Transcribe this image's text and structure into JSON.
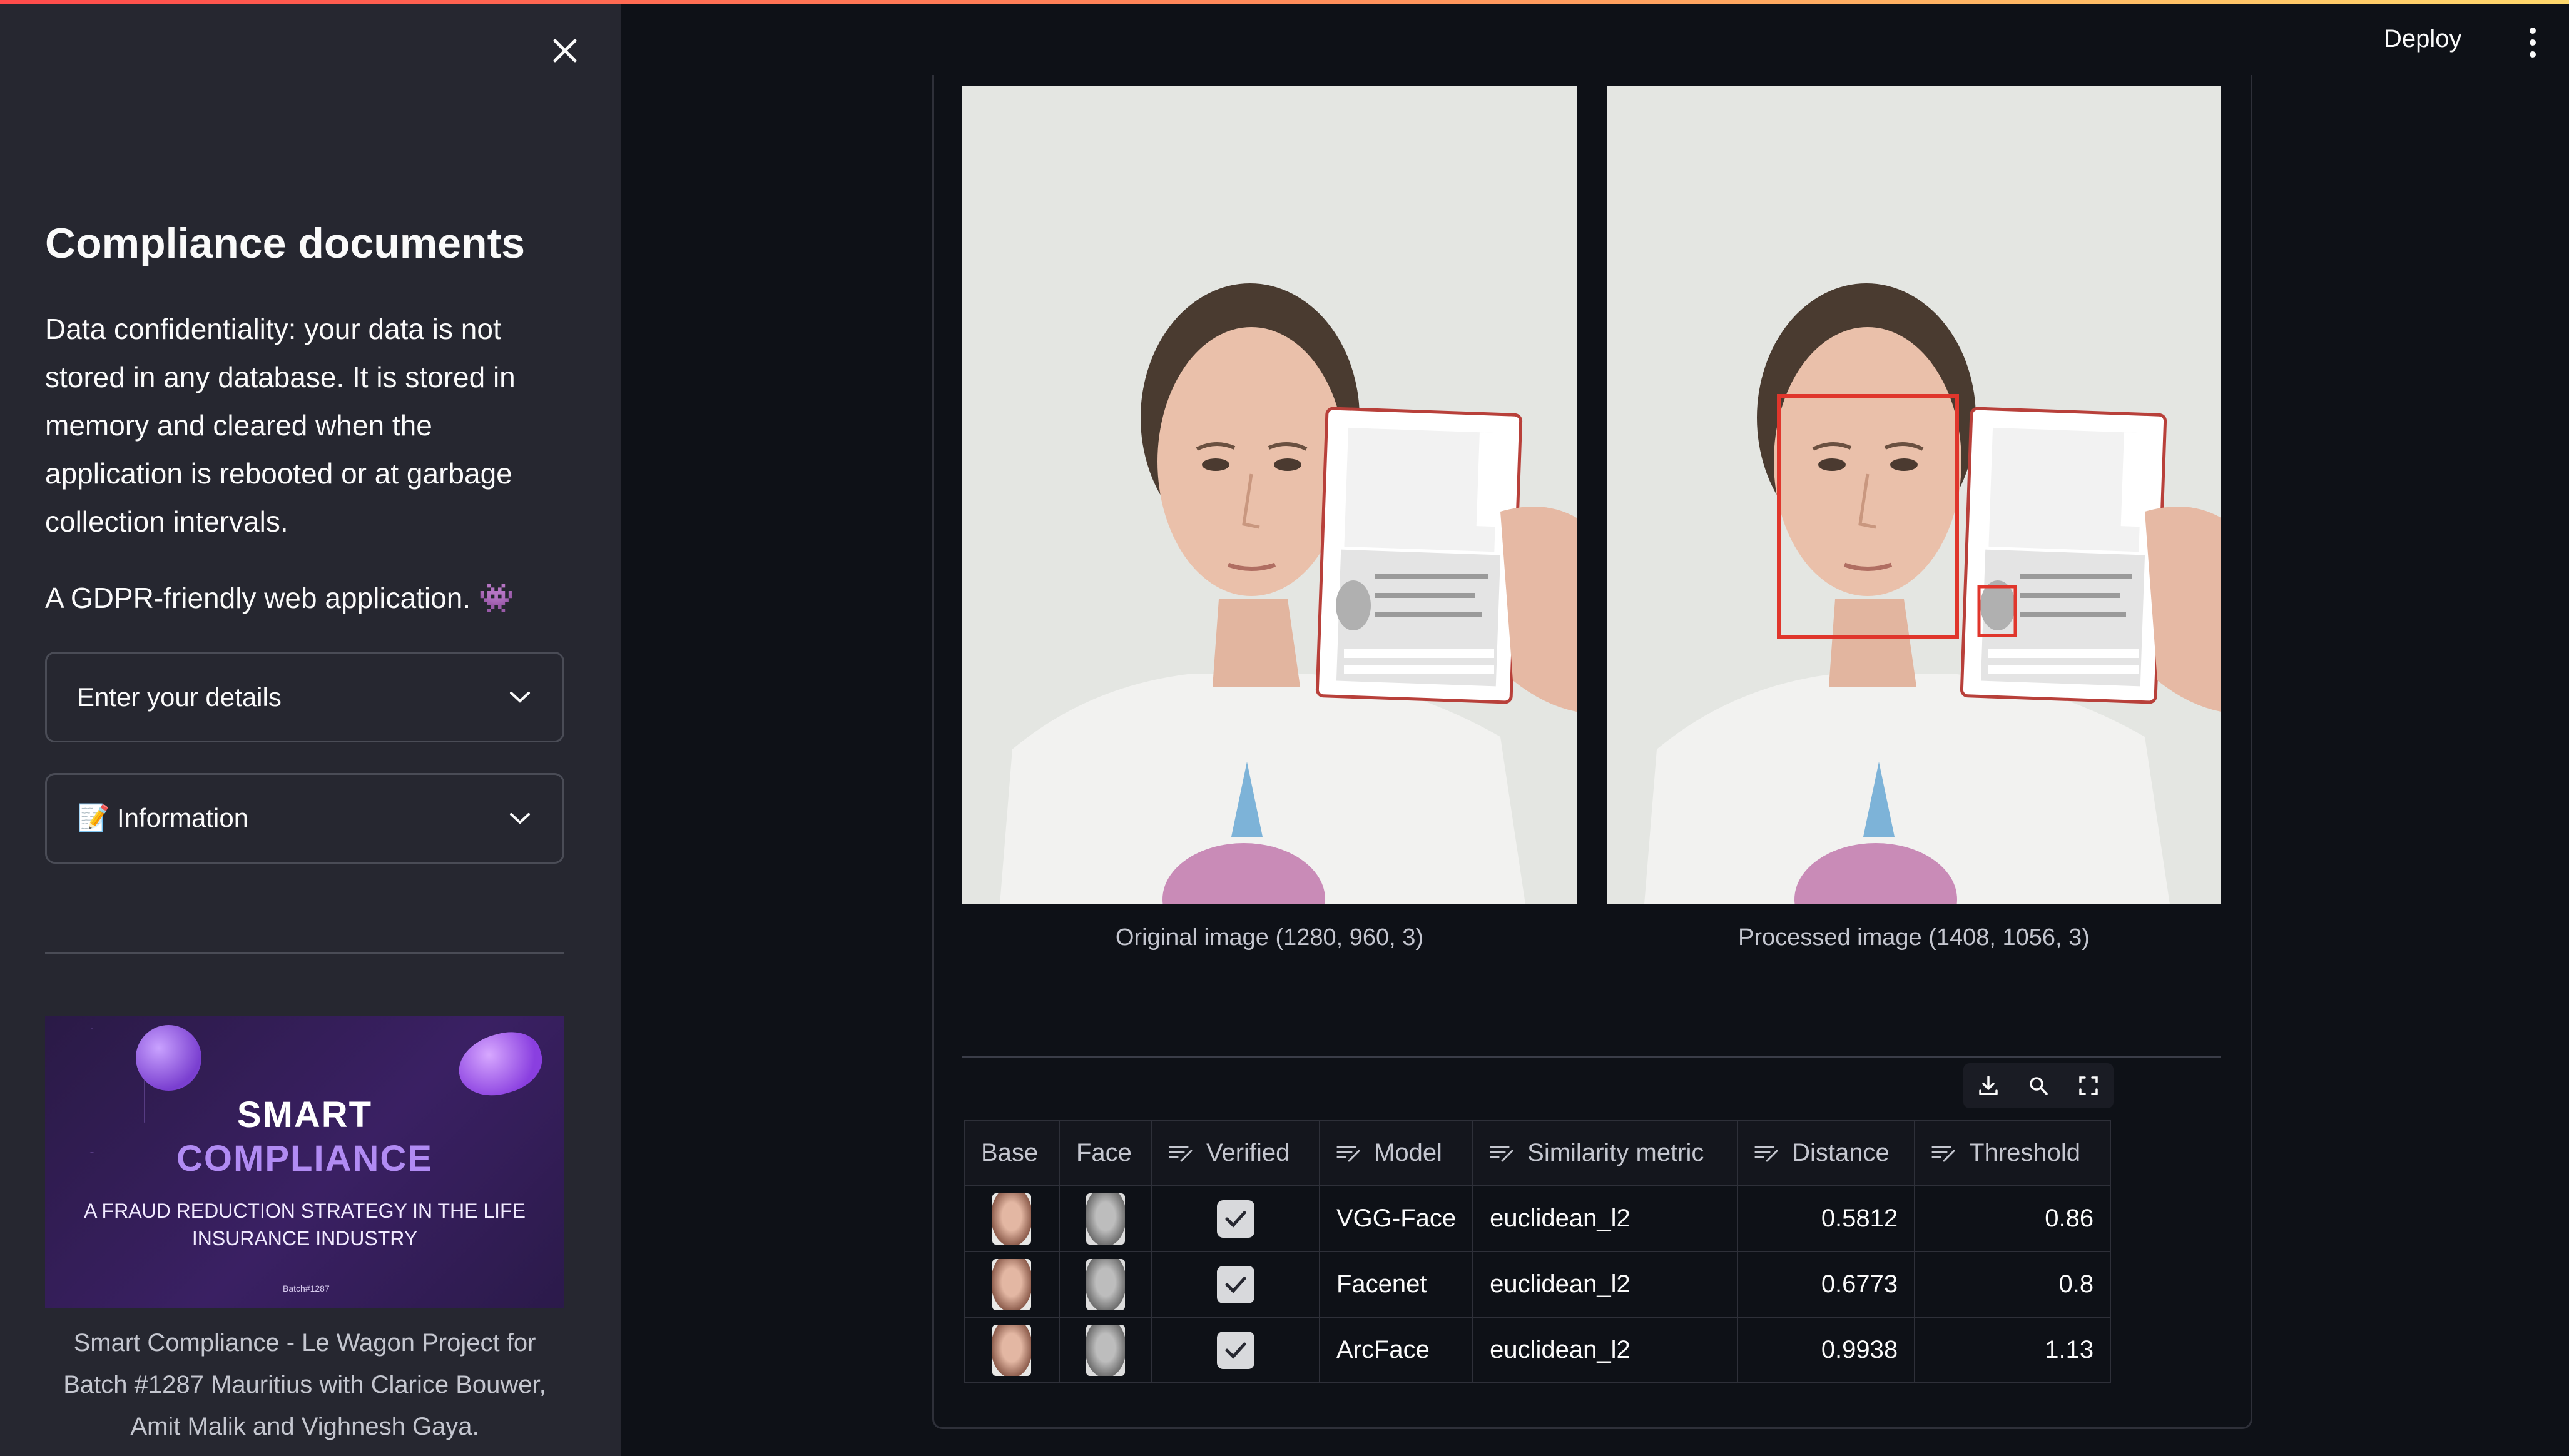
{
  "sidebar": {
    "title": "Compliance documents",
    "paragraph": "Data confidentiality: your data is not stored in any database. It is stored in memory and cleared when the application is rebooted or at garbage collection intervals.",
    "paragraph2": "A GDPR-friendly web application. 👾",
    "expander1": "Enter your details",
    "expander2": "📝 Information",
    "banner": {
      "line1": "SMART",
      "line2": "COMPLIANCE",
      "line3": "A FRAUD REDUCTION STRATEGY IN THE LIFE INSURANCE INDUSTRY",
      "line4": "Batch#1287"
    },
    "caption": "Smart Compliance - Le Wagon Project for Batch #1287 Mauritius with Clarice Bouwer, Amit Malik and Vighnesh Gaya."
  },
  "header": {
    "deploy": "Deploy"
  },
  "images": {
    "original_caption": "Original image (1280, 960, 3)",
    "processed_caption": "Processed image (1408, 1056, 3)"
  },
  "table": {
    "headers": [
      "Base",
      "Face",
      "Verified",
      "Model",
      "Similarity metric",
      "Distance",
      "Threshold"
    ],
    "rows": [
      {
        "verified": true,
        "model": "VGG-Face",
        "metric": "euclidean_l2",
        "distance": "0.5812",
        "threshold": "0.86"
      },
      {
        "verified": true,
        "model": "Facenet",
        "metric": "euclidean_l2",
        "distance": "0.6773",
        "threshold": "0.8"
      },
      {
        "verified": true,
        "model": "ArcFace",
        "metric": "euclidean_l2",
        "distance": "0.9938",
        "threshold": "1.13"
      }
    ]
  },
  "colors": {
    "background": "#0e1117",
    "sidebar": "#262730",
    "accent_box": "#e0362c"
  }
}
